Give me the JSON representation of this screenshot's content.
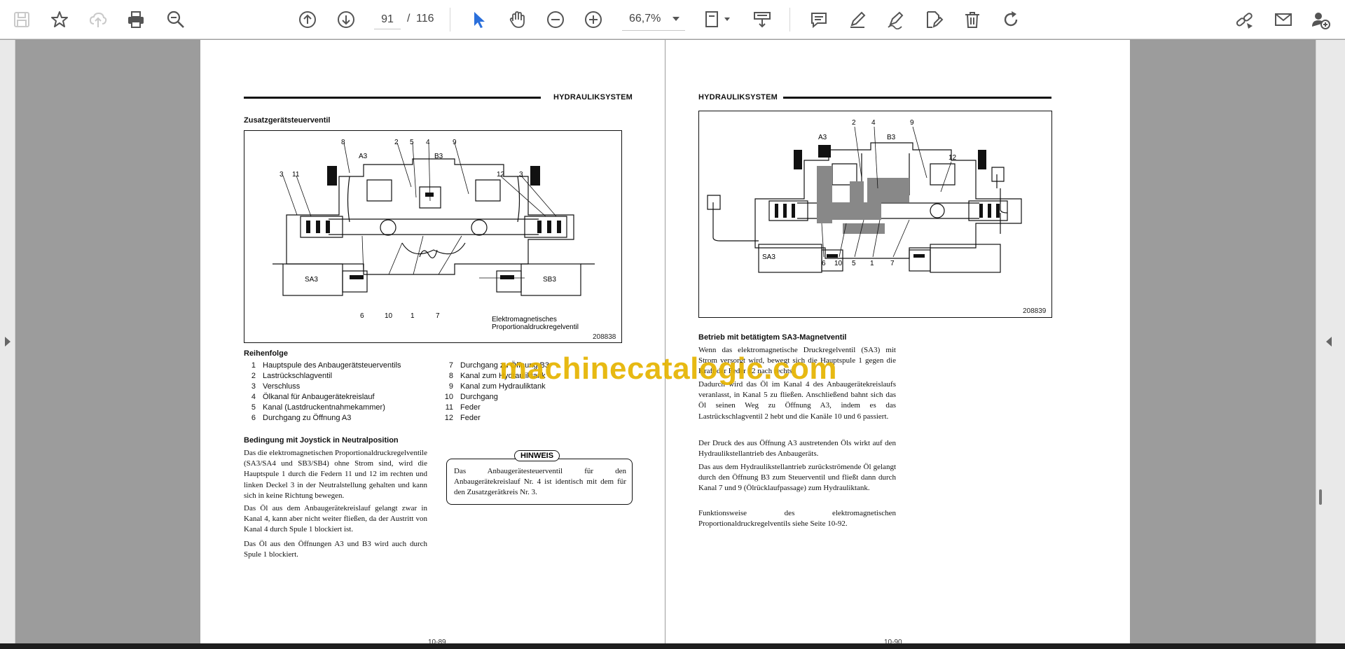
{
  "toolbar": {
    "current_page": "91",
    "page_separator": "/",
    "total_pages": "116",
    "zoom": "66,7%"
  },
  "watermark": "machinecatalogic.com",
  "left_page": {
    "header": "HYDRAULIKSYSTEM",
    "section_title": "Zusatzgerätsteuerventil",
    "figure": {
      "callouts_top": [
        "8",
        "2",
        "5",
        "4",
        "9"
      ],
      "callouts_sides": [
        "3",
        "11",
        "12",
        "3"
      ],
      "callouts_bottom": [
        "6",
        "10",
        "1",
        "7"
      ],
      "ports": [
        "A3",
        "B3"
      ],
      "solenoids": [
        "SA3",
        "SB3"
      ],
      "caption_line1": "Elektromagnetisches",
      "caption_line2": "Proportionaldruckregelventil",
      "figure_number": "208838"
    },
    "list_title": "Reihenfolge",
    "list_left": [
      {
        "num": "1",
        "text": "Hauptspule des Anbaugerätsteuerventils"
      },
      {
        "num": "2",
        "text": "Lastrückschlagventil"
      },
      {
        "num": "3",
        "text": "Verschluss"
      },
      {
        "num": "4",
        "text": "Ölkanal für Anbaugerätekreislauf"
      },
      {
        "num": "5",
        "text": "Kanal (Lastdruckentnahmekammer)"
      },
      {
        "num": "6",
        "text": "Durchgang zu Öffnung A3"
      }
    ],
    "list_right": [
      {
        "num": "7",
        "text": "Durchgang zu Öffnung B3"
      },
      {
        "num": "8",
        "text": "Kanal zum Hydrauliktank"
      },
      {
        "num": "9",
        "text": "Kanal zum Hydrauliktank"
      },
      {
        "num": "10",
        "text": "Durchgang"
      },
      {
        "num": "11",
        "text": "Feder"
      },
      {
        "num": "12",
        "text": "Feder"
      }
    ],
    "subheading": "Bedingung mit Joystick in Neutralposition",
    "para1": "Das die elektromagnetischen Proportionaldruckregelventile (SA3/SA4 und SB3/SB4) ohne Strom sind, wird die Hauptspule 1 durch die Federn 11 und 12 im rechten und linken Deckel 3 in der Neutralstellung gehalten und kann sich in keine Richtung bewegen.",
    "para2": "Das Öl aus dem Anbaugerätekreislauf gelangt zwar in Kanal 4, kann aber nicht weiter fließen, da der Austritt von Kanal 4 durch Spule 1 blockiert ist.",
    "para3": "Das Öl aus den Öffnungen A3 und B3 wird auch durch Spule 1 blockiert.",
    "note_label": "HINWEIS",
    "note_text": "Das Anbaugerätesteuerventil für den Anbaugerätekreislauf Nr. 4 ist identisch mit dem für den Zusatzgerätkreis Nr. 3.",
    "page_number": "10-89"
  },
  "right_page": {
    "header": "HYDRAULIKSYSTEM",
    "figure": {
      "callouts_top": [
        "2",
        "4",
        "9"
      ],
      "callouts_sides": [
        "12"
      ],
      "callouts_bottom": [
        "6",
        "10",
        "5",
        "1",
        "7"
      ],
      "ports": [
        "A3",
        "B3"
      ],
      "solenoids": [
        "SA3"
      ],
      "figure_number": "208839"
    },
    "subheading": "Betrieb mit betätigtem SA3-Magnetventil",
    "para1": "Wenn das elektromagnetische Druckregelventil (SA3) mit Strom versorgt wird, bewegt sich die Hauptspule 1 gegen die Kraft der Feder 12 nach rechts.",
    "para2": "Dadurch wird das Öl im Kanal 4 des Anbaugerätekreislaufs veranlasst, in Kanal 5 zu fließen. Anschließend bahnt sich das Öl seinen Weg zu Öffnung A3, indem es das Lastrückschlagventil 2 hebt und die Kanäle 10 und 6 passiert.",
    "para3": "Der Druck des aus Öffnung A3 austretenden Öls wirkt auf den Hydraulikstellantrieb des Anbaugeräts.",
    "para4": "Das aus dem Hydraulikstellantrieb zurückströmende Öl gelangt durch den Öffnung B3 zum Steuerventil und fließt dann durch Kanal 7 und 9 (Ölrücklaufpassage) zum Hydrauliktank.",
    "para5": "Funktionsweise des elektromagnetischen Proportionaldruckregelventils siehe Seite 10-92.",
    "page_number": "10-90"
  }
}
